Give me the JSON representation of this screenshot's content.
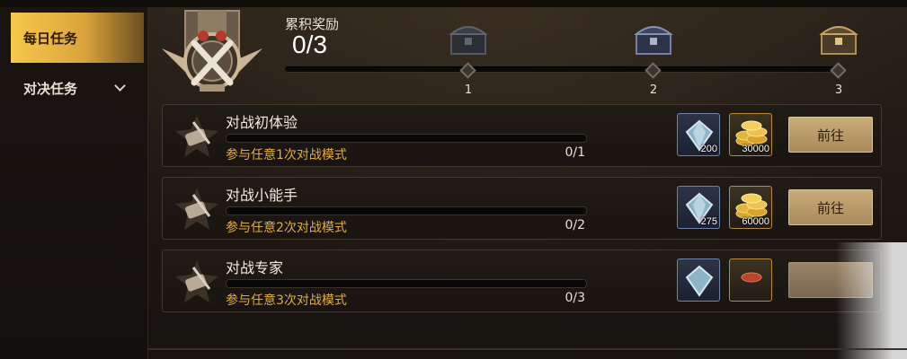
{
  "sidebar": {
    "tabs": [
      {
        "label": "每日任务",
        "active": true
      },
      {
        "label": "对决任务",
        "active": false
      }
    ]
  },
  "header": {
    "reward_title": "累积奖励",
    "reward_progress": "0/3",
    "milestones": [
      "1",
      "2",
      "3"
    ]
  },
  "tasks": [
    {
      "title": "对战初体验",
      "desc": "参与任意1次对战模式",
      "progress": "0/1",
      "progress_fraction": 0,
      "gem_amount": "200",
      "gold_amount": "30000",
      "button": "前往"
    },
    {
      "title": "对战小能手",
      "desc": "参与任意2次对战模式",
      "progress": "0/2",
      "progress_fraction": 0,
      "gem_amount": "275",
      "gold_amount": "60000",
      "button": "前往"
    },
    {
      "title": "对战专家",
      "desc": "参与任意3次对战模式",
      "progress": "0/3",
      "progress_fraction": 0,
      "gem_amount": "",
      "gold_amount": "",
      "button": ""
    }
  ],
  "colors": {
    "accent_gold": "#e0ad3c",
    "active_tab": "#f6c84a",
    "button": "#c9ab7a"
  },
  "icons": {
    "medal": "crossed-swords-medal-icon",
    "chest": "treasure-chest-icon",
    "task": "scroll-quill-icon",
    "gem": "diamond-gem-icon",
    "gold": "gold-coins-icon"
  }
}
